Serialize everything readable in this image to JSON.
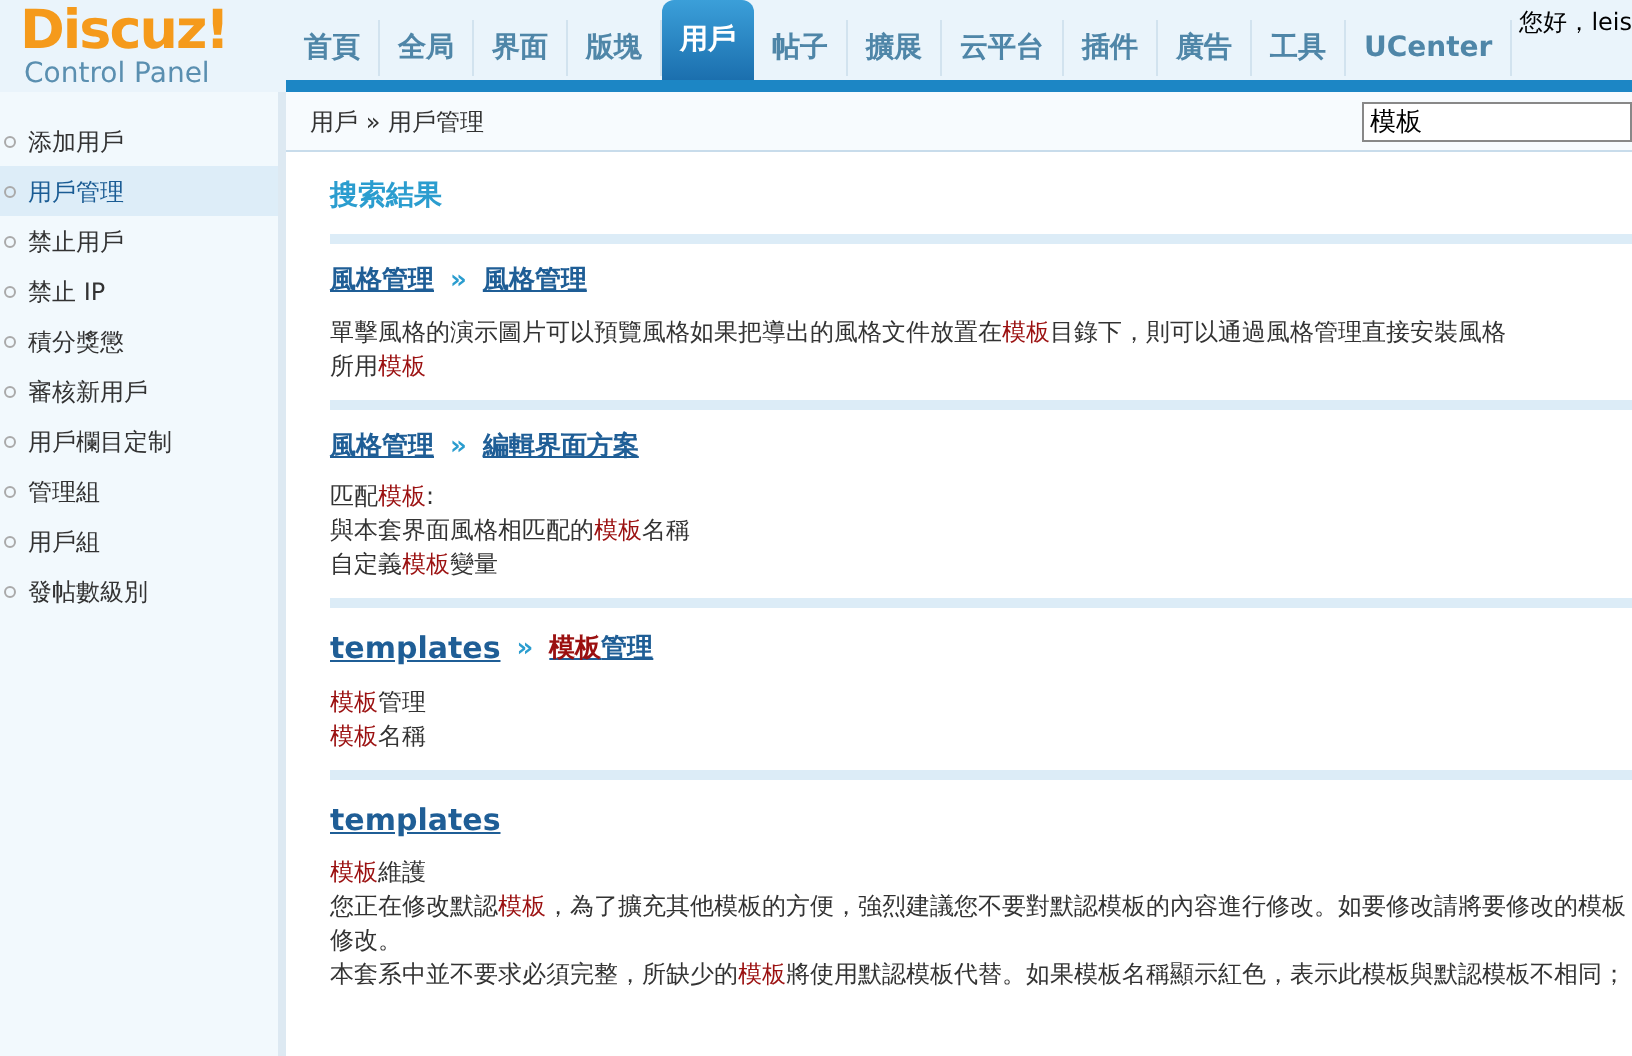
{
  "logo": {
    "title": "Discuz!",
    "subtitle": "Control Panel"
  },
  "greeting": "您好，leis",
  "nav_tabs": [
    {
      "label": "首頁",
      "selected": false
    },
    {
      "label": "全局",
      "selected": false
    },
    {
      "label": "界面",
      "selected": false
    },
    {
      "label": "版塊",
      "selected": false
    },
    {
      "label": "用戶",
      "selected": true
    },
    {
      "label": "帖子",
      "selected": false
    },
    {
      "label": "擴展",
      "selected": false
    },
    {
      "label": "云平台",
      "selected": false
    },
    {
      "label": "插件",
      "selected": false
    },
    {
      "label": "廣告",
      "selected": false
    },
    {
      "label": "工具",
      "selected": false
    },
    {
      "label": "UCenter",
      "selected": false
    }
  ],
  "breadcrumb": "用戶 » 用戶管理",
  "search": {
    "value": "模板"
  },
  "sidebar": {
    "items": [
      {
        "label": "添加用戶",
        "selected": false
      },
      {
        "label": "用戶管理",
        "selected": true
      },
      {
        "label": "禁止用戶",
        "selected": false
      },
      {
        "label": "禁止 IP",
        "selected": false
      },
      {
        "label": "積分獎懲",
        "selected": false
      },
      {
        "label": "審核新用戶",
        "selected": false
      },
      {
        "label": "用戶欄目定制",
        "selected": false
      },
      {
        "label": "管理組",
        "selected": false
      },
      {
        "label": "用戶組",
        "selected": false
      },
      {
        "label": "發帖數級別",
        "selected": false
      }
    ]
  },
  "results": {
    "title": "搜索結果",
    "sections": [
      {
        "path": [
          "風格管理",
          "風格管理"
        ],
        "separator": "»",
        "lines": [
          "單擊風格的演示圖片可以預覽風格如果把導出的風格文件放置在**模板**目錄下，則可以通過風格管理直接安裝風格",
          "所用**模板**"
        ]
      },
      {
        "path": [
          "風格管理",
          "編輯界面方案"
        ],
        "separator": "»",
        "lines": [
          "匹配**模板**:",
          "與本套界面風格相匹配的**模板**名稱",
          "自定義**模板**變量"
        ]
      },
      {
        "path": [
          "templates",
          "**模板**管理"
        ],
        "separator": "»",
        "lines": [
          "**模板**管理",
          "**模板**名稱"
        ]
      },
      {
        "path": [
          "templates"
        ],
        "lines": [
          "**模板**維護",
          "您正在修改默認**模板**，為了擴充其他模板的方便，強烈建議您不要對默認模板的內容進行修改。如要修改請將要修改的模板",
          "修改。",
          "本套系中並不要求必須完整，所缺少的**模板**將使用默認模板代替。如果模板名稱顯示紅色，表示此模板與默認模板不相同；"
        ]
      }
    ]
  }
}
